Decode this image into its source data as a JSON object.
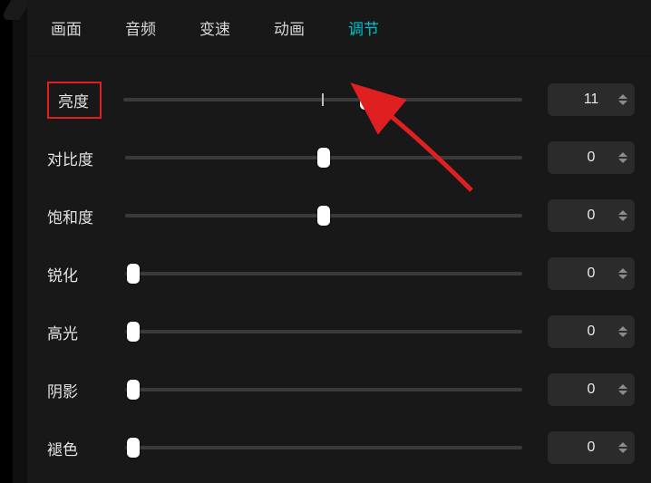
{
  "colors": {
    "accent": "#00c1cd",
    "highlight_box": "#e02020"
  },
  "tabs": [
    {
      "id": "picture",
      "label": "画面",
      "active": false
    },
    {
      "id": "audio",
      "label": "音频",
      "active": false
    },
    {
      "id": "speed",
      "label": "变速",
      "active": false
    },
    {
      "id": "animation",
      "label": "动画",
      "active": false
    },
    {
      "id": "adjust",
      "label": "调节",
      "active": true
    }
  ],
  "sliders": [
    {
      "id": "brightness",
      "label": "亮度",
      "value": 11,
      "min": -100,
      "max": 100,
      "center_tick": true,
      "thumb_pct": 61,
      "highlighted": true
    },
    {
      "id": "contrast",
      "label": "对比度",
      "value": 0,
      "min": -100,
      "max": 100,
      "center_tick": false,
      "thumb_pct": 50,
      "highlighted": false
    },
    {
      "id": "saturation",
      "label": "饱和度",
      "value": 0,
      "min": -100,
      "max": 100,
      "center_tick": false,
      "thumb_pct": 50,
      "highlighted": false
    },
    {
      "id": "sharpen",
      "label": "锐化",
      "value": 0,
      "min": 0,
      "max": 100,
      "center_tick": false,
      "thumb_pct": 2,
      "highlighted": false
    },
    {
      "id": "highlight",
      "label": "高光",
      "value": 0,
      "min": 0,
      "max": 100,
      "center_tick": false,
      "thumb_pct": 2,
      "highlighted": false
    },
    {
      "id": "shadow",
      "label": "阴影",
      "value": 0,
      "min": 0,
      "max": 100,
      "center_tick": false,
      "thumb_pct": 2,
      "highlighted": false
    },
    {
      "id": "fade",
      "label": "褪色",
      "value": 0,
      "min": 0,
      "max": 100,
      "center_tick": false,
      "thumb_pct": 2,
      "highlighted": false
    }
  ],
  "annotation": {
    "type": "arrow",
    "color": "#e02020",
    "points_from": "lower-right",
    "points_to": "brightness-slider-thumb"
  }
}
